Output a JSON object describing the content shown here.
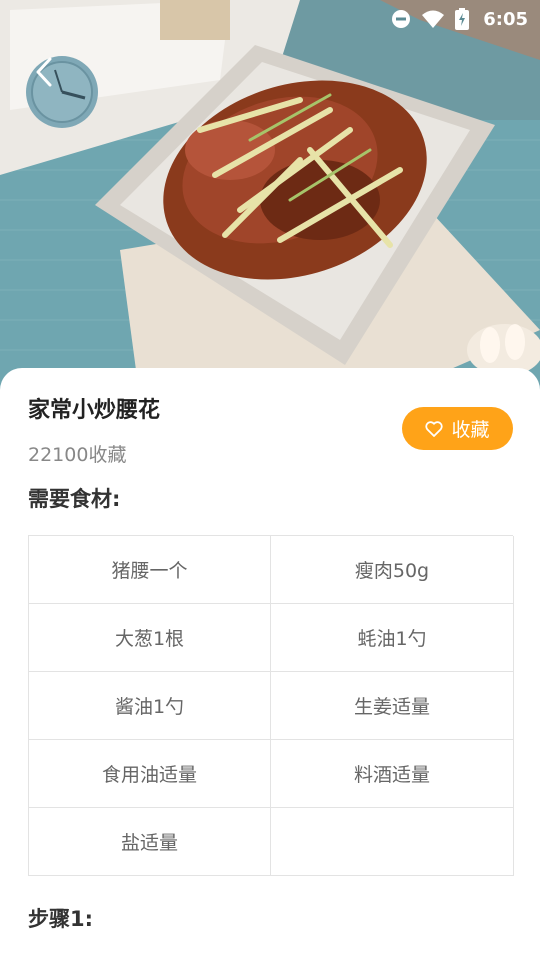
{
  "status_bar": {
    "time": "6:05",
    "icons": [
      "do-not-disturb-icon",
      "wifi-icon",
      "battery-charging-icon"
    ]
  },
  "recipe": {
    "title": "家常小炒腰花",
    "favorites_text": "22100收藏",
    "favorite_button_label": "收藏",
    "ingredients_heading": "需要食材:",
    "ingredients": [
      "猪腰一个",
      "瘦肉50g",
      "大葱1根",
      "蚝油1勺",
      "酱油1勺",
      "生姜适量",
      "食用油适量",
      "料酒适量",
      "盐适量",
      ""
    ],
    "step_heading": "步骤1:"
  },
  "colors": {
    "accent": "#ffa318",
    "table_border": "#e3e3e3",
    "title_text": "#222222",
    "muted_text": "#888888"
  }
}
